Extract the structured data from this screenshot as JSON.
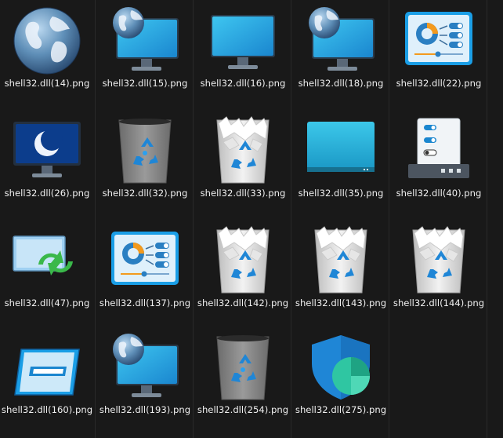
{
  "files": [
    {
      "name": "shell32.dll(14).png",
      "icon": "globe-icon"
    },
    {
      "name": "shell32.dll(15).png",
      "icon": "monitor-globe-icon"
    },
    {
      "name": "shell32.dll(16).png",
      "icon": "monitor-icon"
    },
    {
      "name": "shell32.dll(18).png",
      "icon": "monitor-globe-icon"
    },
    {
      "name": "shell32.dll(22).png",
      "icon": "control-panel-icon"
    },
    {
      "name": "shell32.dll(26).png",
      "icon": "monitor-moon-icon"
    },
    {
      "name": "shell32.dll(32).png",
      "icon": "recycle-bin-empty-icon"
    },
    {
      "name": "shell32.dll(33).png",
      "icon": "recycle-bin-full-icon"
    },
    {
      "name": "shell32.dll(35).png",
      "icon": "desktop-screen-icon"
    },
    {
      "name": "shell32.dll(40).png",
      "icon": "settings-toggles-icon"
    },
    {
      "name": "shell32.dll(47).png",
      "icon": "display-sync-icon"
    },
    {
      "name": "shell32.dll(137).png",
      "icon": "control-panel-icon"
    },
    {
      "name": "shell32.dll(142).png",
      "icon": "recycle-bin-full-icon"
    },
    {
      "name": "shell32.dll(143).png",
      "icon": "recycle-bin-full-icon"
    },
    {
      "name": "shell32.dll(144).png",
      "icon": "recycle-bin-full-icon"
    },
    {
      "name": "shell32.dll(160).png",
      "icon": "window-panel-icon"
    },
    {
      "name": "shell32.dll(193).png",
      "icon": "monitor-globe-icon"
    },
    {
      "name": "shell32.dll(254).png",
      "icon": "recycle-bin-empty-icon"
    },
    {
      "name": "shell32.dll(275).png",
      "icon": "shield-chart-icon"
    }
  ],
  "colors": {
    "background": "#191919",
    "label": "#f0f0f0",
    "screen_blue": "#1e8fd8",
    "accent_orange": "#f39a1e"
  }
}
